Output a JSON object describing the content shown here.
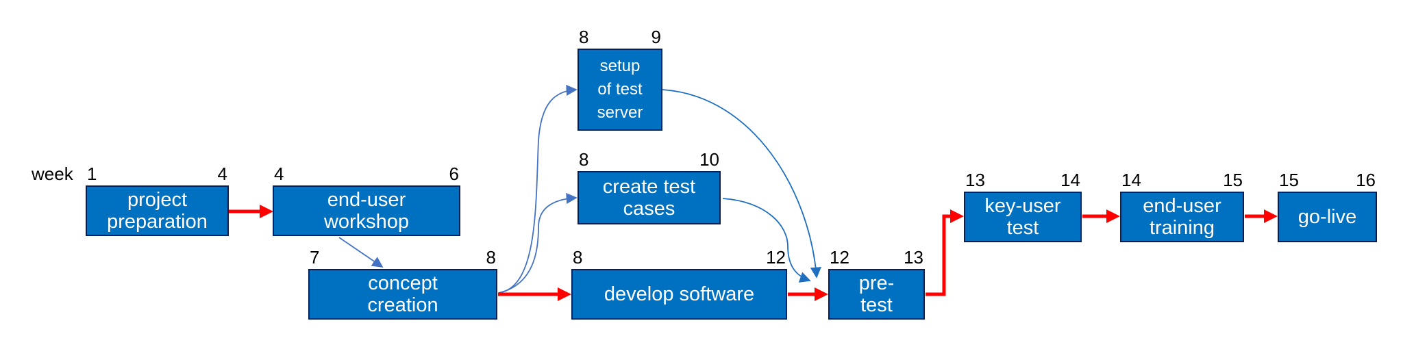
{
  "week_label": "week",
  "colors": {
    "box_fill": "#0070C0",
    "box_border": "#002060",
    "critical_path": "#FF0000",
    "dependency": "#4472C4"
  },
  "tasks": [
    {
      "id": "project-preparation",
      "label": "project\npreparation",
      "start": "1",
      "end": "4"
    },
    {
      "id": "end-user-workshop",
      "label": "end-user\nworkshop",
      "start": "4",
      "end": "6"
    },
    {
      "id": "concept-creation",
      "label": "concept\ncreation",
      "start": "7",
      "end": "8"
    },
    {
      "id": "setup-of-test-server",
      "label": "setup\nof test\nserver",
      "start": "8",
      "end": "9"
    },
    {
      "id": "create-test-cases",
      "label": "create test\ncases",
      "start": "8",
      "end": "10"
    },
    {
      "id": "develop-software",
      "label": "develop software",
      "start": "8",
      "end": "12"
    },
    {
      "id": "pre-test",
      "label": "pre-\ntest",
      "start": "12",
      "end": "13"
    },
    {
      "id": "key-user-test",
      "label": "key-user\ntest",
      "start": "13",
      "end": "14"
    },
    {
      "id": "end-user-training",
      "label": "end-user\ntraining",
      "start": "14",
      "end": "15"
    },
    {
      "id": "go-live",
      "label": "go-live",
      "start": "15",
      "end": "16"
    }
  ],
  "dependencies": [
    {
      "from": "project-preparation",
      "to": "end-user-workshop",
      "critical": true
    },
    {
      "from": "end-user-workshop",
      "to": "concept-creation",
      "critical": false
    },
    {
      "from": "concept-creation",
      "to": "setup-of-test-server",
      "critical": false
    },
    {
      "from": "concept-creation",
      "to": "create-test-cases",
      "critical": false
    },
    {
      "from": "concept-creation",
      "to": "develop-software",
      "critical": true
    },
    {
      "from": "setup-of-test-server",
      "to": "pre-test",
      "critical": false
    },
    {
      "from": "create-test-cases",
      "to": "pre-test",
      "critical": false
    },
    {
      "from": "develop-software",
      "to": "pre-test",
      "critical": true
    },
    {
      "from": "pre-test",
      "to": "key-user-test",
      "critical": true
    },
    {
      "from": "key-user-test",
      "to": "end-user-training",
      "critical": true
    },
    {
      "from": "end-user-training",
      "to": "go-live",
      "critical": true
    }
  ]
}
